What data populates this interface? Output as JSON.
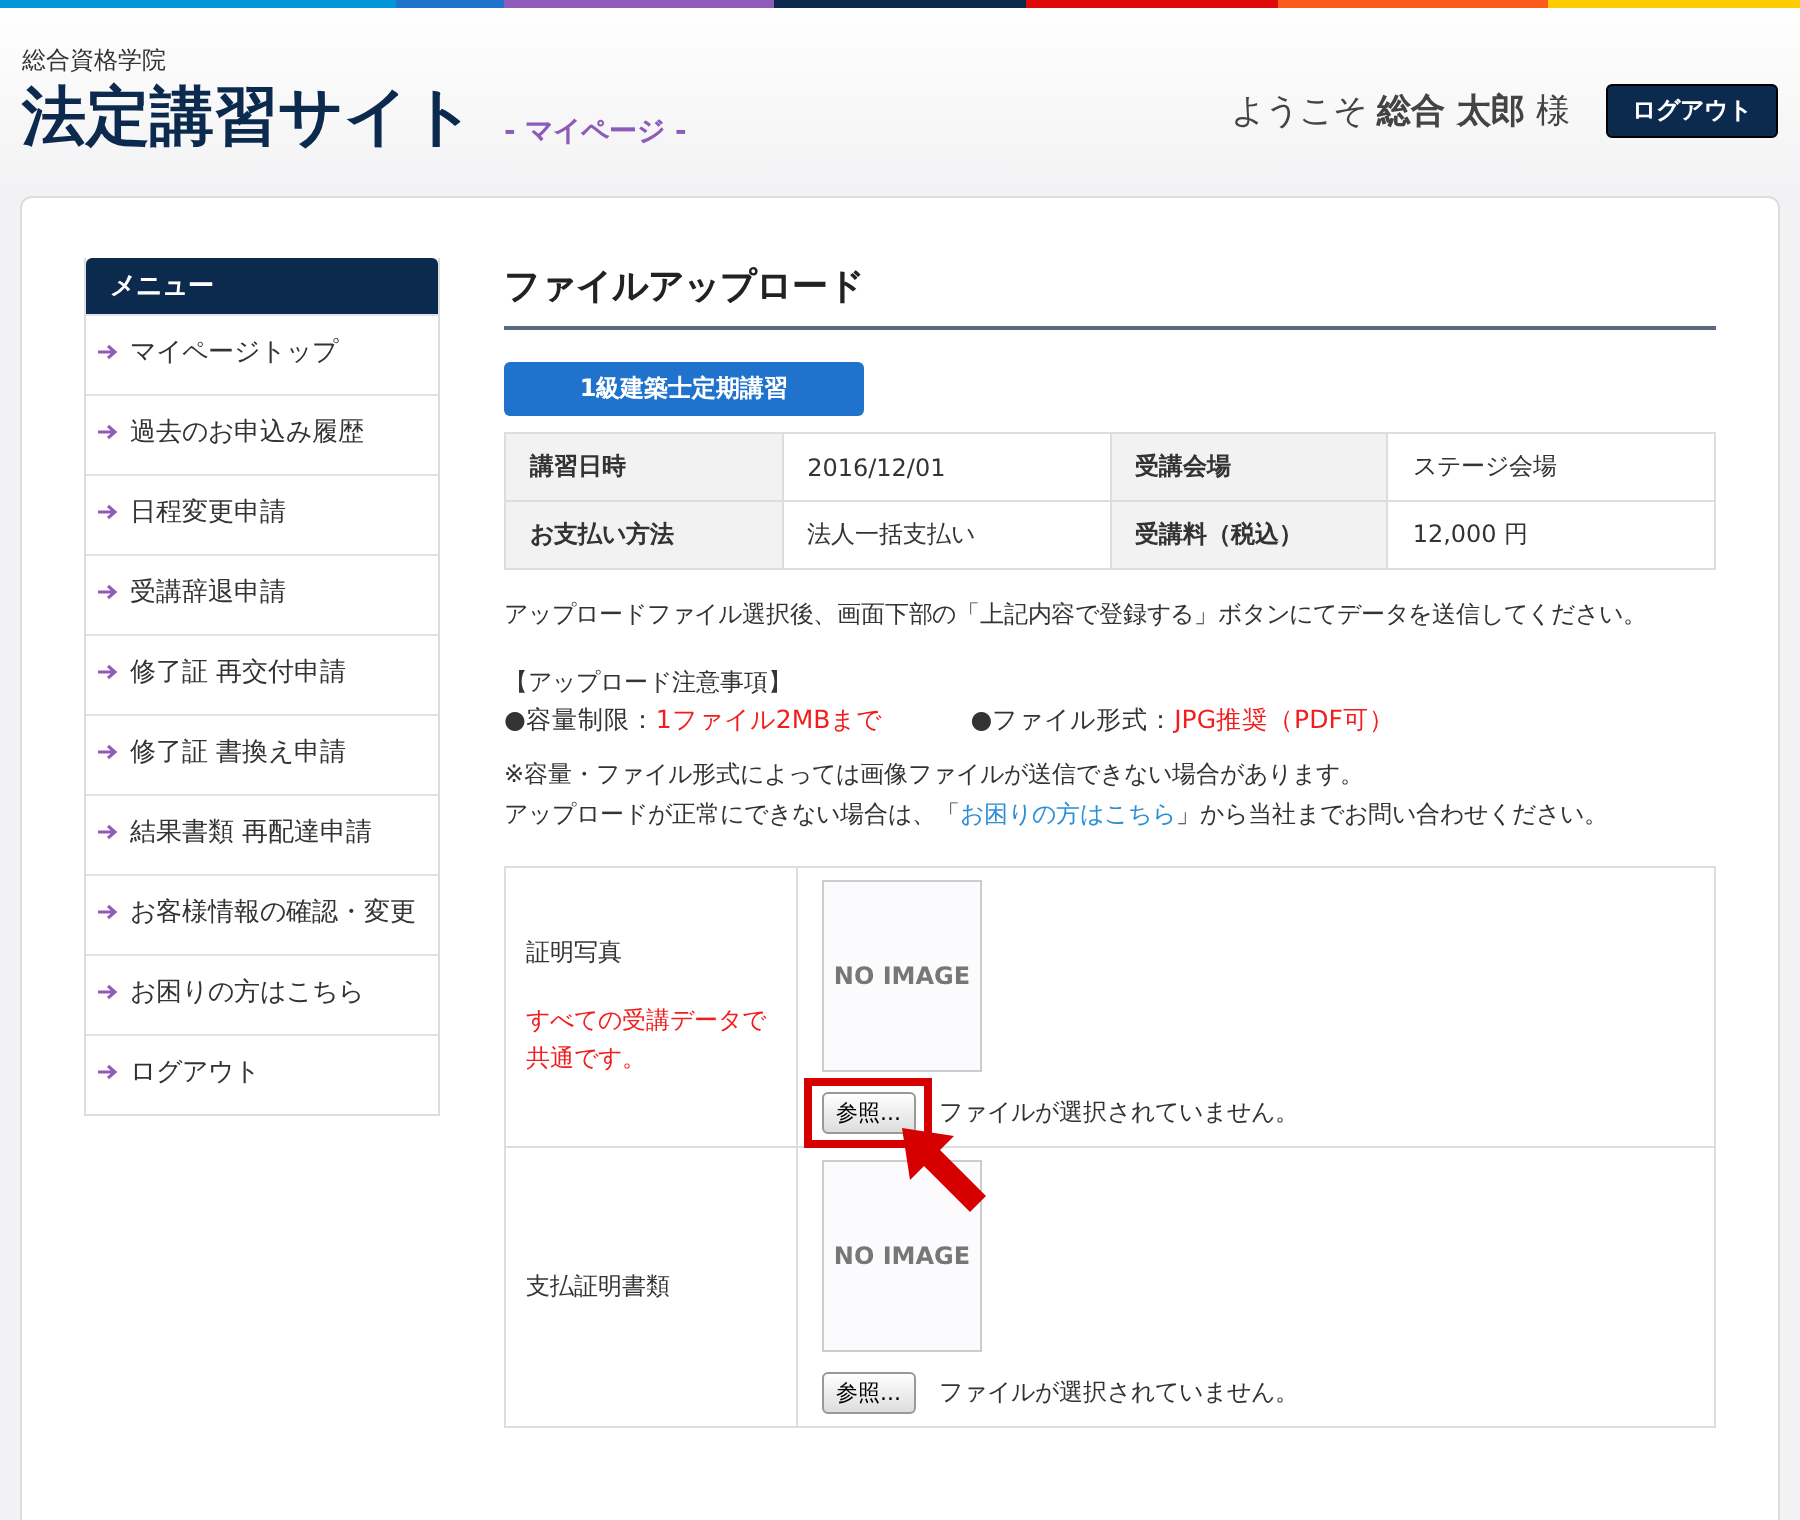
{
  "header": {
    "org": "総合資格学院",
    "site_title": "法定講習サイト",
    "subtitle": "- マイページ -",
    "welcome": "ようこそ **総合 太郎** 様",
    "logout_button": "ログアウト"
  },
  "sidebar": {
    "title": "メニュー",
    "items": [
      {
        "label": "マイページトップ"
      },
      {
        "label": "過去のお申込み履歴"
      },
      {
        "label": "日程変更申請"
      },
      {
        "label": "受講辞退申請"
      },
      {
        "label": "修了証 再交付申請"
      },
      {
        "label": "修了証 書換え申請"
      },
      {
        "label": "結果書類 再配達申請"
      },
      {
        "label": "お客様情報の確認・変更"
      },
      {
        "label": "お困りの方はこちら"
      },
      {
        "label": "ログアウト"
      }
    ]
  },
  "main": {
    "title": "ファイルアップロード",
    "course_badge": "1級建築士定期講習",
    "info_table": [
      [
        {
          "label": "講習日時",
          "value": "2016/12/01"
        },
        {
          "label": "受講会場",
          "value": "ステージ会場"
        }
      ],
      [
        {
          "label": "お支払い方法",
          "value": "法人一括支払い"
        },
        {
          "label": "受講料（税込）",
          "value": "12,000 円"
        }
      ]
    ],
    "instruction": "アップロードファイル選択後、画面下部の「上記内容で登録する」ボタンにてデータを送信してください。",
    "notes_title": "【アップロード注意事項】",
    "limits": [
      {
        "label": "●容量制限：",
        "value": "1ファイル2MBまで"
      },
      {
        "label": "●ファイル形式：",
        "value": "JPG推奨（PDF可）"
      }
    ],
    "warning": "※容量・ファイル形式によっては画像ファイルが送信できない場合があります。",
    "help_prefix": "アップロードが正常にできない場合は、「",
    "help_link": "お困りの方はこちら",
    "help_suffix": "」から当社までお問い合わせください。",
    "uploads": [
      {
        "label": "証明写真",
        "note": "すべての受講データで共通です。",
        "preview": "NO IMAGE",
        "browse_button": "参照...",
        "status": "ファイルが選択されていません。",
        "highlighted": true
      },
      {
        "label": "支払証明書類",
        "preview": "NO IMAGE",
        "browse_button": "参照...",
        "status": "ファイルが選択されていません。",
        "highlighted": false
      }
    ]
  }
}
